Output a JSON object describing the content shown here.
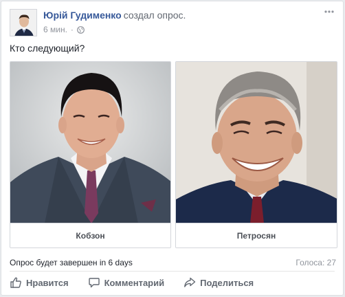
{
  "post": {
    "author_name": "Юрій Гудименко",
    "action": "создал опрос.",
    "time": "6 мин.",
    "meta_separator": "·",
    "audience_icon": "globe-icon",
    "text": "Кто следующий?"
  },
  "poll": {
    "options": [
      {
        "label": "Кобзон"
      },
      {
        "label": "Петросян"
      }
    ],
    "status": "Опрос будет завершен in 6 days",
    "votes": "Голоса: 27"
  },
  "actions": {
    "like_label": "Нравится",
    "comment_label": "Комментарий",
    "share_label": "Поделиться"
  },
  "colors": {
    "link": "#365899",
    "muted": "#90949c",
    "action_text": "#616770"
  }
}
